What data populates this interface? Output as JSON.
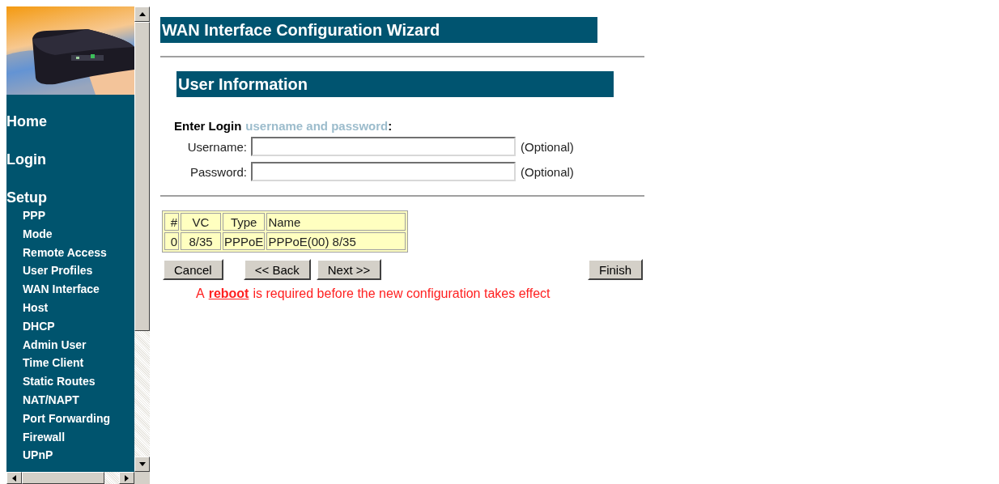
{
  "sidebar": {
    "items": [
      {
        "label": "Home",
        "kind": "section"
      },
      {
        "label": "Login",
        "kind": "section"
      },
      {
        "label": "Setup",
        "kind": "section"
      },
      {
        "label": "PPP",
        "kind": "sub"
      },
      {
        "label": "Mode",
        "kind": "sub"
      },
      {
        "label": "Remote Access",
        "kind": "sub"
      },
      {
        "label": "User Profiles",
        "kind": "sub"
      },
      {
        "label": "WAN Interface",
        "kind": "sub"
      },
      {
        "label": "Host",
        "kind": "sub"
      },
      {
        "label": "DHCP",
        "kind": "sub"
      },
      {
        "label": "Admin User",
        "kind": "sub"
      },
      {
        "label": "Time Client",
        "kind": "sub"
      },
      {
        "label": "Static Routes",
        "kind": "sub"
      },
      {
        "label": "NAT/NAPT",
        "kind": "sub"
      },
      {
        "label": "Port Forwarding",
        "kind": "sub"
      },
      {
        "label": "Firewall",
        "kind": "sub"
      },
      {
        "label": "UPnP",
        "kind": "sub"
      }
    ]
  },
  "page_title": "WAN Interface Configuration Wizard",
  "section_title": "User Information",
  "prompt": {
    "label": "Enter Login",
    "hint": "username and password",
    "suffix": ":"
  },
  "fields": [
    {
      "label": "Username:",
      "note": "(Optional)"
    },
    {
      "label": "Password:",
      "note": "(Optional)"
    }
  ],
  "table": {
    "columns": [
      "#",
      "VC",
      "Type",
      "Name"
    ],
    "rows": [
      [
        "0",
        "8/35",
        "PPPoE",
        "PPPoE(00) 8/35"
      ]
    ]
  },
  "buttons": {
    "cancel": "Cancel",
    "back": "<< Back",
    "next": "Next >>",
    "finish": "Finish"
  },
  "notice": {
    "before": "A",
    "link": "reboot",
    "after": "is required before the new configuration takes effect"
  }
}
